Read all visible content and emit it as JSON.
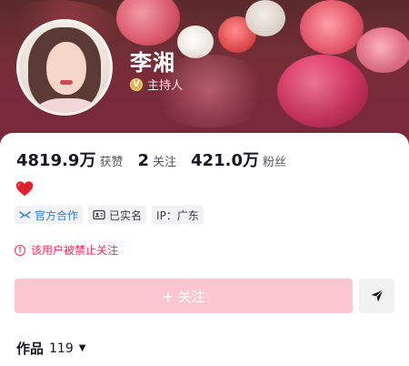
{
  "profile": {
    "name": "李湘",
    "role": "主持人",
    "verified_badge": "V"
  },
  "stats": [
    {
      "value": "4819.9万",
      "label": "获赞"
    },
    {
      "value": "2",
      "label": "关注"
    },
    {
      "value": "421.0万",
      "label": "粉丝"
    }
  ],
  "bio_emoji": "heart",
  "tags": [
    {
      "icon": "official-cooperation-icon",
      "label": "官方合作"
    },
    {
      "icon": "id-card-icon",
      "label": "已实名"
    },
    {
      "icon": "",
      "label": "IP：广东"
    }
  ],
  "warning": {
    "icon": "exclamation-circle-icon",
    "text": "该用户被禁止关注"
  },
  "actions": {
    "follow_label": "+ 关注",
    "share_icon": "send-icon"
  },
  "works": {
    "label": "作品",
    "count": "119"
  },
  "colors": {
    "accent": "#fe2c55",
    "follow_disabled": "#fbc6cf",
    "official_blue": "#2d7ce0",
    "badge_gold": "#e2b54d"
  }
}
